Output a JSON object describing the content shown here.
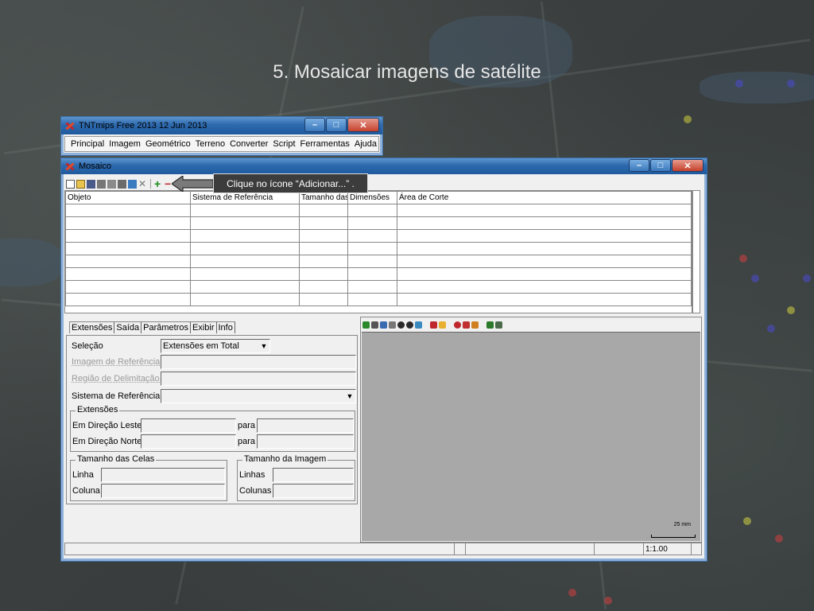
{
  "slide": {
    "title": "5. Mosaicar imagens de satélite"
  },
  "main_window": {
    "title": "TNTmips Free 2013   12 Jun 2013",
    "menu": [
      "Principal",
      "Imagem",
      "Geométrico",
      "Terreno",
      "Converter",
      "Script",
      "Ferramentas",
      "Ajuda"
    ]
  },
  "mosaic_window": {
    "title": "Mosaico",
    "toolbar_icons": [
      "new-icon",
      "open-icon",
      "save-icon",
      "print-icon",
      "layers-icon",
      "export-icon",
      "grid-icon",
      "delete-icon",
      "add-icon",
      "remove-icon"
    ],
    "columns": [
      "Objeto",
      "Sistema de Referência",
      "Tamanho das",
      "Dimensões",
      "Área de Corte"
    ],
    "row_count": 8,
    "tabs": [
      "Extensões",
      "Saída",
      "Parâmetros",
      "Exibir",
      "Info"
    ],
    "active_tab": "Extensões",
    "form": {
      "selecao_label": "Seleção",
      "selecao_value": "Extensões em Total",
      "imagem_ref_button": "Imagem de Referência...",
      "regiao_button": "Região de Delimitação...",
      "sistema_label": "Sistema de Referência",
      "extensoes_group": "Extensões",
      "leste_label": "Em Direção Leste",
      "norte_label": "Em Direção Norte",
      "para_label": "para",
      "celas_group": "Tamanho das Celas",
      "linha_label": "Linha",
      "coluna_label": "Coluna",
      "imagem_group": "Tamanho da Imagem",
      "linhas_label": "Linhas",
      "colunas_label": "Colunas"
    },
    "viewer": {
      "scale_label": "25 mm"
    },
    "status": {
      "scale": "1:1.00"
    }
  },
  "callout": {
    "text": "Clique no ícone “Adicionar...” ."
  },
  "colors": {
    "titlebar": "#2d69ad",
    "canvas": "#a8a8a8",
    "callout_bg": "#3c3c3c"
  }
}
